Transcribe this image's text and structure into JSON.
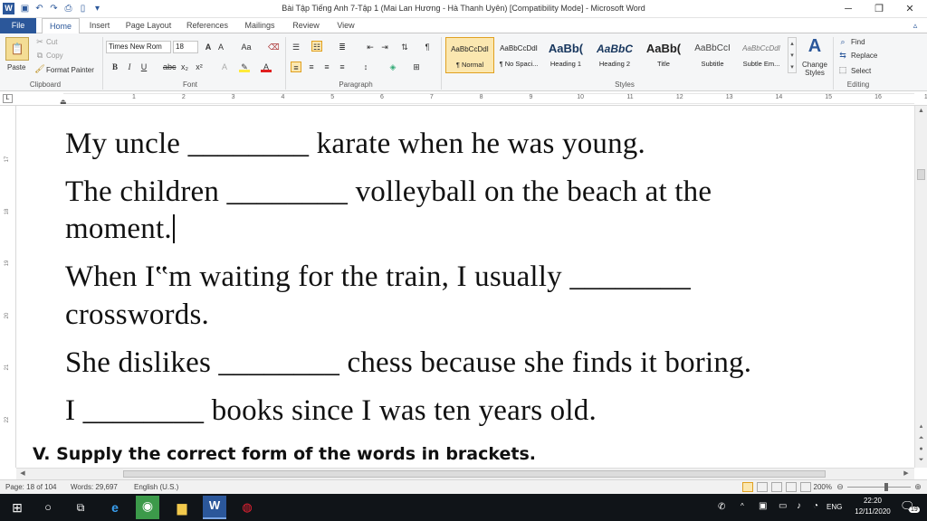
{
  "window": {
    "title": "Bài Tập Tiếng Anh 7-Tập 1 (Mai Lan Hương - Hà Thanh Uyên) [Compatibility Mode] - Microsoft Word"
  },
  "tabs": {
    "file": "File",
    "items": [
      "Home",
      "Insert",
      "Page Layout",
      "References",
      "Mailings",
      "Review",
      "View"
    ]
  },
  "clipboard": {
    "paste": "Paste",
    "cut": "Cut",
    "copy": "Copy",
    "format_painter": "Format Painter",
    "label": "Clipboard"
  },
  "font": {
    "family": "Times New Rom",
    "size": "18",
    "label": "Font"
  },
  "paragraph": {
    "label": "Paragraph"
  },
  "styles": {
    "tiles": [
      {
        "preview": "AaBbCcDdI",
        "name": "¶ Normal"
      },
      {
        "preview": "AaBbCcDdI",
        "name": "¶ No Spaci..."
      },
      {
        "preview": "AaBb(",
        "name": "Heading 1"
      },
      {
        "preview": "AaBbC",
        "name": "Heading 2"
      },
      {
        "preview": "AaBb(",
        "name": "Title"
      },
      {
        "preview": "AaBbCcI",
        "name": "Subtitle"
      },
      {
        "preview": "AaBbCcDdI",
        "name": "Subtle Em..."
      }
    ],
    "change_styles": "Change Styles",
    "label": "Styles"
  },
  "editing": {
    "find": "Find",
    "replace": "Replace",
    "select": "Select",
    "label": "Editing"
  },
  "ruler": {
    "numbers": [
      "1",
      "2",
      "3",
      "4",
      "5",
      "6",
      "7",
      "8",
      "9",
      "10",
      "11",
      "12",
      "13",
      "14",
      "15",
      "16",
      "17"
    ],
    "vnumbers": [
      "17",
      "18",
      "19",
      "20",
      "21",
      "22"
    ]
  },
  "document": {
    "lines": [
      "My uncle ________ karate when he was young.",
      "The children ________ volleyball on the beach at the",
      "moment.",
      "When I‟m waiting for the train, I usually ________",
      "crosswords.",
      "She dislikes ________ chess because she finds it boring.",
      "I ________ books since I was ten years old."
    ],
    "heading": "V. Supply the correct form of the words in brackets."
  },
  "statusbar": {
    "page": "Page: 18 of 104",
    "words": "Words: 29,697",
    "language": "English (U.S.)",
    "zoom": "200%"
  },
  "taskbar": {
    "language": "ENG",
    "time": "22:20",
    "date": "12/11/2020",
    "notifications": "19"
  },
  "colors": {
    "accent": "#2b579a",
    "taskbar": "#101418"
  }
}
